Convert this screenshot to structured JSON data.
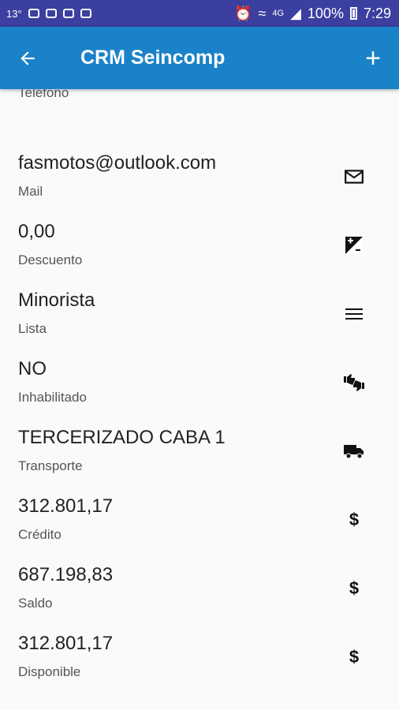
{
  "status_bar": {
    "temperature": "13°",
    "battery": "100%",
    "time": "7:29",
    "network": "4G"
  },
  "app_bar": {
    "title": "CRM Seincomp",
    "add_label": "+"
  },
  "fields": [
    {
      "value": "",
      "label": "Teléfono",
      "icon": "phone-icon"
    },
    {
      "value": "fasmotos@outlook.com",
      "label": "Mail",
      "icon": "mail-icon"
    },
    {
      "value": "0,00",
      "label": "Descuento",
      "icon": "exposure-icon"
    },
    {
      "value": "Minorista",
      "label": "Lista",
      "icon": "list-icon"
    },
    {
      "value": "NO",
      "label": "Inhabilitado",
      "icon": "thumbs-up-down-icon"
    },
    {
      "value": "TERCERIZADO CABA 1",
      "label": "Transporte",
      "icon": "truck-icon"
    },
    {
      "value": "312.801,17",
      "label": "Crédito",
      "icon": "dollar-icon"
    },
    {
      "value": "687.198,83",
      "label": "Saldo",
      "icon": "dollar-icon"
    },
    {
      "value": "312.801,17",
      "label": "Disponible",
      "icon": "dollar-icon"
    }
  ],
  "symbols": {
    "dollar": "$"
  },
  "colors": {
    "status_bar": "#3a3fa0",
    "app_bar": "#1a82c9",
    "background": "#fafafa"
  }
}
